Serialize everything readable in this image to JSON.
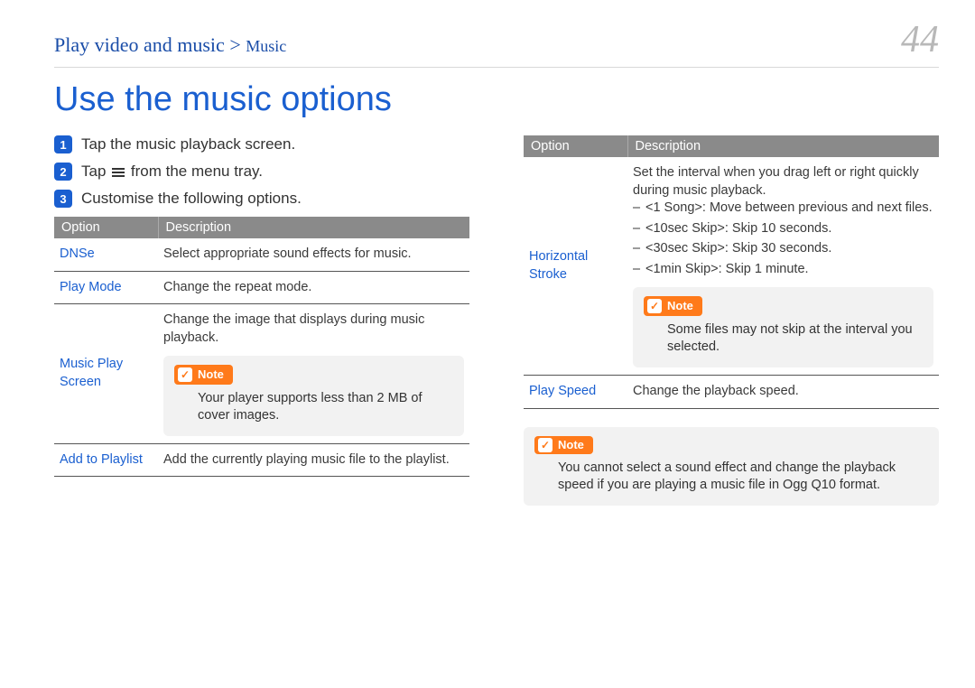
{
  "breadcrumb": {
    "main": "Play video and music",
    "sep": ">",
    "sub": "Music"
  },
  "page_number": "44",
  "heading": "Use the music options",
  "steps": [
    {
      "n": "1",
      "pre": "Tap the music playback screen.",
      "post": ""
    },
    {
      "n": "2",
      "pre": "Tap ",
      "post": " from the menu tray."
    },
    {
      "n": "3",
      "pre": "Customise the following options.",
      "post": ""
    }
  ],
  "table_header": {
    "option": "Option",
    "description": "Description"
  },
  "left_rows": {
    "dnse": {
      "opt": "DNSe",
      "desc": "Select appropriate sound effects for music."
    },
    "playmode": {
      "opt": "Play Mode",
      "desc": "Change the repeat mode."
    },
    "musicplay": {
      "opt": "Music Play Screen",
      "desc": "Change the image that displays during music playback.",
      "note_label": "Note",
      "note_body": "Your player supports less than 2 MB of cover images."
    },
    "addplaylist": {
      "opt": "Add to Playlist",
      "desc": "Add the currently playing music file to the playlist."
    }
  },
  "right_rows": {
    "hstroke": {
      "opt": "Horizontal Stroke",
      "intro": "Set the interval when you drag left or right quickly during music playback.",
      "items": [
        "<1 Song>: Move between previous and next files.",
        "<10sec Skip>: Skip 10 seconds.",
        "<30sec Skip>: Skip 30 seconds.",
        "<1min Skip>: Skip 1 minute."
      ],
      "note_label": "Note",
      "note_body": "Some files may not skip at the interval you selected."
    },
    "playspeed": {
      "opt": "Play Speed",
      "desc": "Change the playback speed."
    }
  },
  "bottom_note": {
    "label": "Note",
    "body": "You cannot select a sound effect and change the playback speed if you are playing a music file in Ogg Q10 format."
  }
}
